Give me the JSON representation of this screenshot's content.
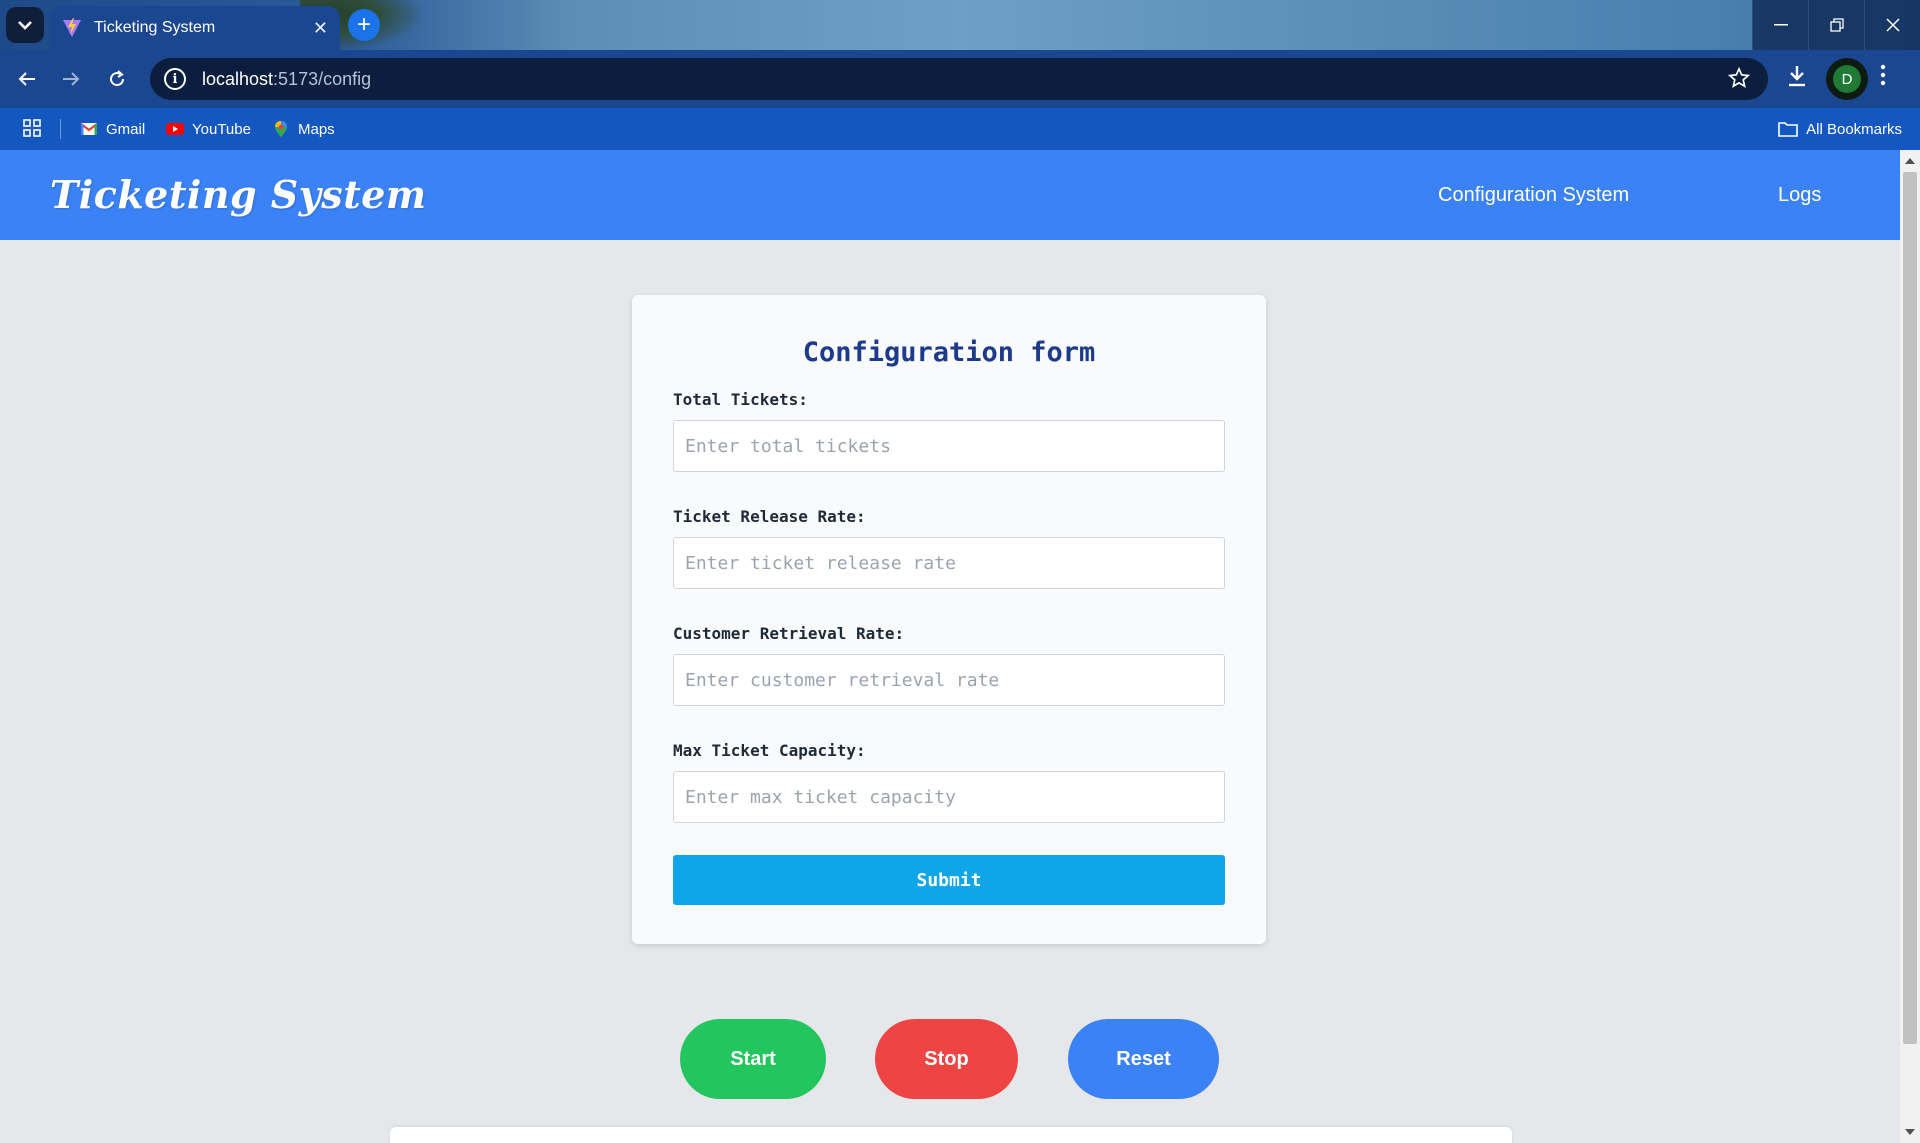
{
  "browser": {
    "tab": {
      "title": "Ticketing System"
    },
    "address": {
      "host": "localhost",
      "path": ":5173/config"
    },
    "avatar_initial": "D",
    "bookmarks": [
      {
        "label": "Gmail",
        "icon": "gmail-icon"
      },
      {
        "label": "YouTube",
        "icon": "youtube-icon"
      },
      {
        "label": "Maps",
        "icon": "maps-icon"
      }
    ],
    "all_bookmarks_label": "All Bookmarks"
  },
  "header": {
    "brand": "Ticketing System",
    "nav": [
      {
        "label": "Configuration System"
      },
      {
        "label": "Logs"
      }
    ]
  },
  "form": {
    "title": "Configuration form",
    "fields": [
      {
        "label": "Total Tickets:",
        "placeholder": "Enter total tickets",
        "value": ""
      },
      {
        "label": "Ticket Release Rate:",
        "placeholder": "Enter ticket release rate",
        "value": ""
      },
      {
        "label": "Customer Retrieval Rate:",
        "placeholder": "Enter customer retrieval rate",
        "value": ""
      },
      {
        "label": "Max Ticket Capacity:",
        "placeholder": "Enter max ticket capacity",
        "value": ""
      }
    ],
    "submit_label": "Submit"
  },
  "controls": {
    "start_label": "Start",
    "stop_label": "Stop",
    "reset_label": "Reset"
  },
  "colors": {
    "header_bg": "#3b82f6",
    "submit_bg": "#0ea5e9",
    "start_bg": "#22c55e",
    "stop_bg": "#ef4444",
    "reset_bg": "#3b82f6",
    "form_title": "#1e3a8a"
  }
}
